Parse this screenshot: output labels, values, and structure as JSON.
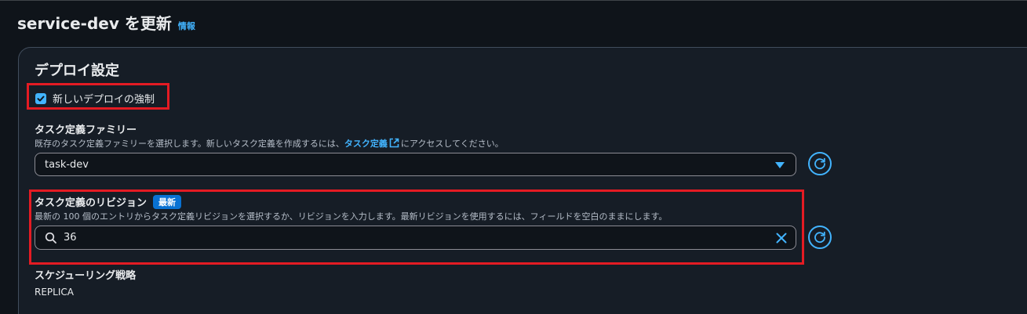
{
  "header": {
    "title": "service-dev を更新",
    "info_link": "情報"
  },
  "deploy_settings": {
    "section_title": "デプロイ設定",
    "force_new_deployment": {
      "label": "新しいデプロイの強制",
      "checked": true
    }
  },
  "task_definition_family": {
    "label": "タスク定義ファミリー",
    "description_before": "既存のタスク定義ファミリーを選択します。新しいタスク定義を作成するには、",
    "description_link": "タスク定義",
    "description_after": "にアクセスしてください。",
    "selected_value": "task-dev"
  },
  "task_definition_revision": {
    "label": "タスク定義のリビジョン",
    "badge": "最新",
    "description": "最新の 100 個のエントリからタスク定義リビジョンを選択するか、リビジョンを入力します。最新リビジョンを使用するには、フィールドを空白のままにします。",
    "input_value": "36"
  },
  "scheduling_strategy": {
    "label": "スケジューリング戦略",
    "value": "REPLICA"
  },
  "colors": {
    "accent": "#42b4ff",
    "badge": "#0972d3",
    "highlight": "#e41b23",
    "background": "#0f141a",
    "panel": "#161d26"
  },
  "icons": [
    "check-icon",
    "external-link-icon",
    "chevron-down-icon",
    "refresh-icon",
    "search-icon",
    "close-icon"
  ]
}
